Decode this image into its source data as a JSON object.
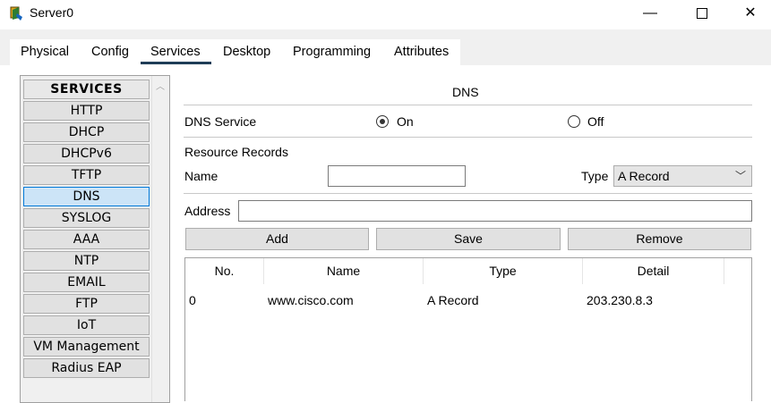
{
  "window": {
    "title": "Server0",
    "minimize": "—",
    "close": "✕"
  },
  "tabs": [
    "Physical",
    "Config",
    "Services",
    "Desktop",
    "Programming",
    "Attributes"
  ],
  "active_tab": "Services",
  "services": {
    "header": "SERVICES",
    "items": [
      "HTTP",
      "DHCP",
      "DHCPv6",
      "TFTP",
      "DNS",
      "SYSLOG",
      "AAA",
      "NTP",
      "EMAIL",
      "FTP",
      "IoT",
      "VM Management",
      "Radius EAP"
    ],
    "selected": "DNS"
  },
  "dns": {
    "title": "DNS",
    "service_label": "DNS Service",
    "on_label": "On",
    "off_label": "Off",
    "service_state": "On",
    "resource_records_label": "Resource Records",
    "name_label": "Name",
    "name_value": "",
    "type_label": "Type",
    "type_value": "A Record",
    "address_label": "Address",
    "address_value": "",
    "add_label": "Add",
    "save_label": "Save",
    "remove_label": "Remove"
  },
  "table": {
    "columns": [
      "No.",
      "Name",
      "Type",
      "Detail"
    ],
    "rows": [
      {
        "no": "0",
        "name": "www.cisco.com",
        "type": "A Record",
        "detail": "203.230.8.3"
      }
    ]
  },
  "colors": {
    "selected_bg": "#cce4f7",
    "selected_border": "#0078d7",
    "active_tab_line": "#1f3d57"
  }
}
